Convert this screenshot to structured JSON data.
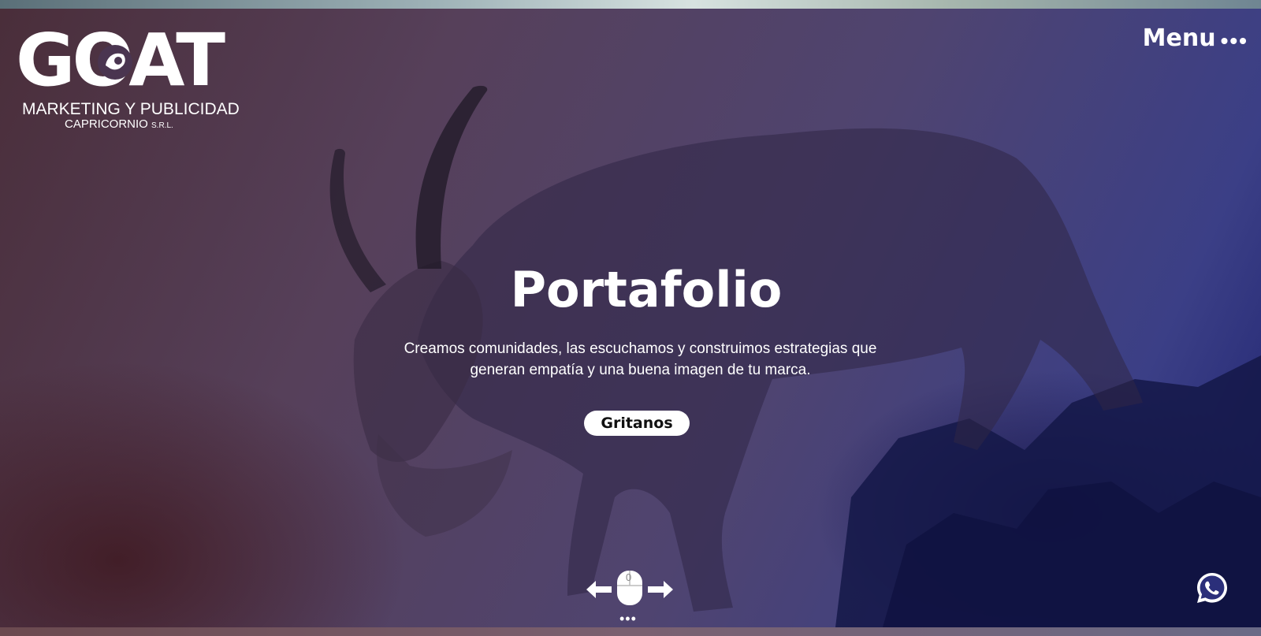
{
  "brand": {
    "logo_word": "GOAT",
    "line1": "MARKETING Y PUBLICIDAD",
    "line2": "CAPRICORNIO",
    "line2_suffix": "S.R.L."
  },
  "nav": {
    "menu_label": "Menu",
    "menu_dots": "•••"
  },
  "hero": {
    "title": "Portafolio",
    "subtitle": "Creamos comunidades, las escuchamos y construimos estrategias que generan empatía y una buena imagen de tu marca.",
    "cta_label": "Gritanos",
    "background_image": "mountain-goat-on-rocks"
  },
  "scroll_hint": {
    "mouse_label": "0",
    "dots": "•••",
    "icons": [
      "arrow-left-icon",
      "mouse-icon",
      "arrow-right-icon"
    ]
  },
  "floating": {
    "whatsapp_icon": "whatsapp-icon",
    "whatsapp_color": "#ffffff"
  },
  "colors": {
    "overlay_left": "#4a2e3a",
    "overlay_mid": "#4f4470",
    "overlay_right": "#1e2270",
    "text": "#ffffff",
    "button_bg": "#ffffff",
    "button_text": "#111111"
  }
}
